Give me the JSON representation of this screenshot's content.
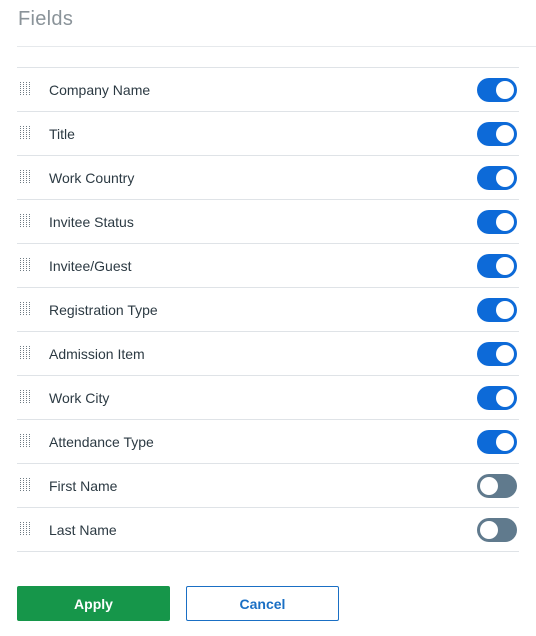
{
  "header": {
    "title": "Fields"
  },
  "fields": [
    {
      "label": "Company Name",
      "enabled": true
    },
    {
      "label": "Title",
      "enabled": true
    },
    {
      "label": "Work Country",
      "enabled": true
    },
    {
      "label": "Invitee Status",
      "enabled": true
    },
    {
      "label": "Invitee/Guest",
      "enabled": true
    },
    {
      "label": "Registration Type",
      "enabled": true
    },
    {
      "label": "Admission Item",
      "enabled": true
    },
    {
      "label": "Work City",
      "enabled": true
    },
    {
      "label": "Attendance Type",
      "enabled": true
    },
    {
      "label": "First Name",
      "enabled": false
    },
    {
      "label": "Last Name",
      "enabled": false
    }
  ],
  "actions": {
    "apply_label": "Apply",
    "cancel_label": "Cancel"
  },
  "colors": {
    "toggle_on": "#0d6ad8",
    "toggle_off": "#607a8d",
    "apply": "#16964a",
    "cancel": "#1a6fc4"
  }
}
